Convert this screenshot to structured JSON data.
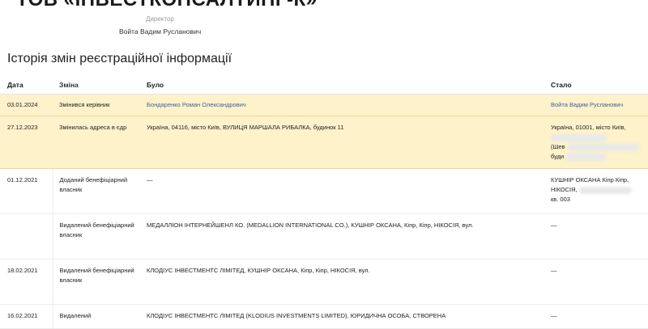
{
  "header": {
    "company": "ТОВ «ІНВЕСТКОНСАЛТИНГ-К»",
    "director_role": "Директор",
    "director_name": "Войта Вадим Русланович"
  },
  "section_title": "Історія змін реєстраційної інформації",
  "columns": {
    "date": "Дата",
    "change": "Зміна",
    "was": "Було",
    "now": "Стало"
  },
  "rows": [
    {
      "date": "03.01.2024",
      "change": "Змінився керівник",
      "was": "Бондаренко Роман Олександрович",
      "now": "Войта Вадим Русланович"
    },
    {
      "date": "27.12.2023",
      "change": "Змінилась адреса в єдр",
      "was": "Україна, 04116, місто Київ, ВУЛИЦЯ МАРШАЛА РИБАЛКА, будинок 11",
      "now_line1": "Україна, 01001, місто Київ,",
      "now_line3": "(Шев",
      "now_line4": "буди"
    },
    {
      "date": "01.12.2021",
      "change": "Доданий бенефіціарний власник",
      "was": "—",
      "now_line1": "КУШНІР ОКСАНА Кіпр Кіпр,",
      "now_line2": "НІКОСІЯ,",
      "now_line3": "кв. 003"
    },
    {
      "date": "",
      "change": "Видалений бенефіціарний власник",
      "was": "МЕДАЛЛІОН ІНТЕРНЕЙШЕНЛ КО. (MEDALLION INTERNATIONAL CO.), КУШНІР ОКСАНА, Кіпр, Кіпр, НІКОСІЯ, вул.",
      "now": "—"
    },
    {
      "date": "18.02.2021",
      "change": "Видалений бенефіціарний власник",
      "was": "КЛОДІУС ІНВЕСТМЕНТС ЛІМІТЕД, КУШНІР ОКСАНА, Кіпр, Кіпр, НІКОСІЯ, вул.",
      "now": "—"
    },
    {
      "date": "16.02.2021",
      "change": "Видалений",
      "was": "КЛОДІУС ІНВЕСТМЕНТС ЛІМІТЕД (KLODIUS INVESTMENTS LIMITED), ЮРИДИЧНА ОСОБА, СТВОРЕНА",
      "now": "—"
    }
  ],
  "colors": {
    "highlight": "#fdf2c9",
    "link": "#3d5fa8"
  }
}
